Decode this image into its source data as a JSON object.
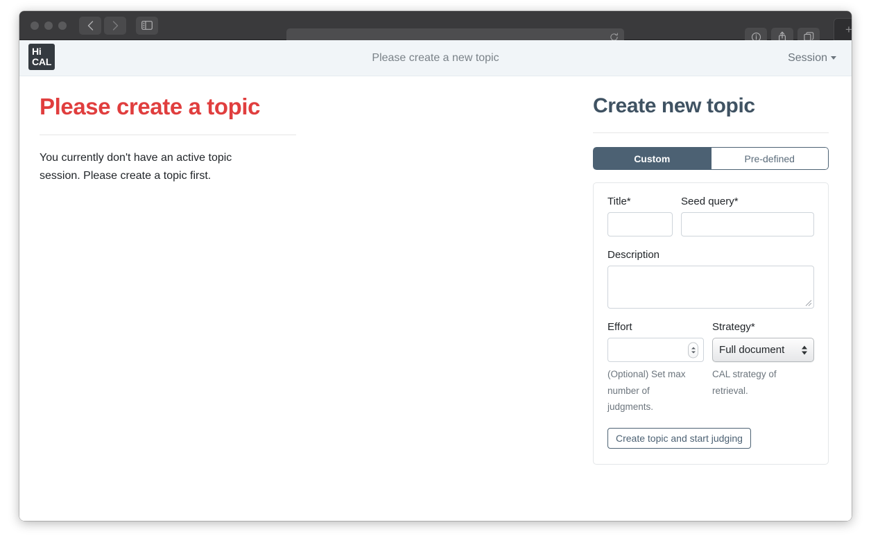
{
  "browser": {
    "address_value": "",
    "address_placeholder": "",
    "back_icon": "chevron-left-icon",
    "forward_icon": "chevron-right-icon",
    "sidebar_icon": "sidebar-toggle-icon",
    "reload_icon": "reload-icon",
    "info_icon": "info-icon",
    "share_icon": "share-icon",
    "tabs_icon": "show-tabs-icon",
    "newtab_label": "+"
  },
  "app_header": {
    "logo_line1": "Hi",
    "logo_line2": "CAL",
    "title": "Please create a new topic",
    "session_label": "Session"
  },
  "left_panel": {
    "heading": "Please create a topic",
    "body": "You currently don't have an active topic session. Please create a topic first."
  },
  "right_panel": {
    "heading": "Create new topic",
    "tabs": [
      {
        "label": "Custom",
        "active": true
      },
      {
        "label": "Pre-defined",
        "active": false
      }
    ],
    "form": {
      "title_label": "Title*",
      "title_value": "",
      "seed_label": "Seed query*",
      "seed_value": "",
      "description_label": "Description",
      "description_value": "",
      "effort_label": "Effort",
      "effort_value": "",
      "effort_hint": "(Optional) Set max number of judgments.",
      "strategy_label": "Strategy*",
      "strategy_value": "Full document",
      "strategy_hint": "CAL strategy of retrieval.",
      "submit_label": "Create topic and start judging"
    }
  },
  "colors": {
    "accent_red": "#e03e3e",
    "slate": "#4c6173",
    "header_bg": "#f1f5f8",
    "logo_bg": "#343a40"
  }
}
